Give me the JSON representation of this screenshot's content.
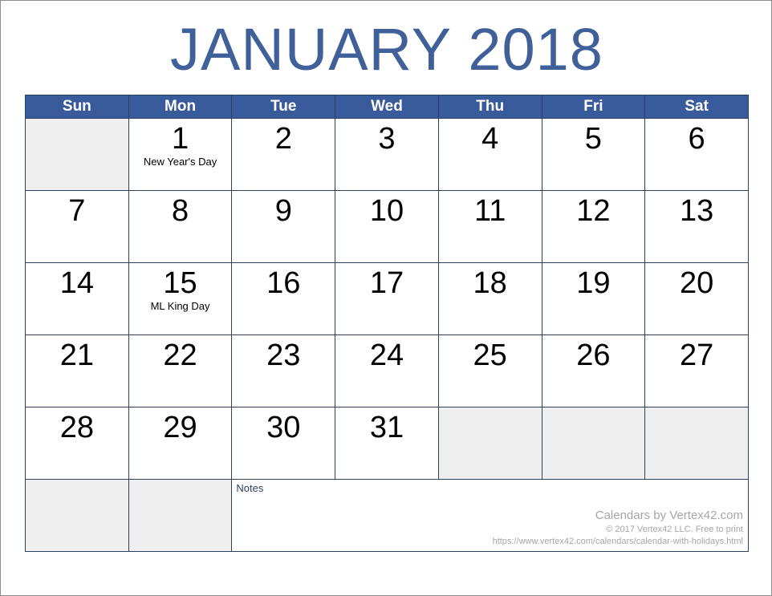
{
  "title": "JANUARY 2018",
  "weekdays": [
    "Sun",
    "Mon",
    "Tue",
    "Wed",
    "Thu",
    "Fri",
    "Sat"
  ],
  "weeks": [
    [
      {
        "day": "",
        "holiday": "",
        "blank": true
      },
      {
        "day": "1",
        "holiday": "New Year's Day",
        "blank": false
      },
      {
        "day": "2",
        "holiday": "",
        "blank": false
      },
      {
        "day": "3",
        "holiday": "",
        "blank": false
      },
      {
        "day": "4",
        "holiday": "",
        "blank": false
      },
      {
        "day": "5",
        "holiday": "",
        "blank": false
      },
      {
        "day": "6",
        "holiday": "",
        "blank": false
      }
    ],
    [
      {
        "day": "7",
        "holiday": "",
        "blank": false
      },
      {
        "day": "8",
        "holiday": "",
        "blank": false
      },
      {
        "day": "9",
        "holiday": "",
        "blank": false
      },
      {
        "day": "10",
        "holiday": "",
        "blank": false
      },
      {
        "day": "11",
        "holiday": "",
        "blank": false
      },
      {
        "day": "12",
        "holiday": "",
        "blank": false
      },
      {
        "day": "13",
        "holiday": "",
        "blank": false
      }
    ],
    [
      {
        "day": "14",
        "holiday": "",
        "blank": false
      },
      {
        "day": "15",
        "holiday": "ML King Day",
        "blank": false
      },
      {
        "day": "16",
        "holiday": "",
        "blank": false
      },
      {
        "day": "17",
        "holiday": "",
        "blank": false
      },
      {
        "day": "18",
        "holiday": "",
        "blank": false
      },
      {
        "day": "19",
        "holiday": "",
        "blank": false
      },
      {
        "day": "20",
        "holiday": "",
        "blank": false
      }
    ],
    [
      {
        "day": "21",
        "holiday": "",
        "blank": false
      },
      {
        "day": "22",
        "holiday": "",
        "blank": false
      },
      {
        "day": "23",
        "holiday": "",
        "blank": false
      },
      {
        "day": "24",
        "holiday": "",
        "blank": false
      },
      {
        "day": "25",
        "holiday": "",
        "blank": false
      },
      {
        "day": "26",
        "holiday": "",
        "blank": false
      },
      {
        "day": "27",
        "holiday": "",
        "blank": false
      }
    ],
    [
      {
        "day": "28",
        "holiday": "",
        "blank": false
      },
      {
        "day": "29",
        "holiday": "",
        "blank": false
      },
      {
        "day": "30",
        "holiday": "",
        "blank": false
      },
      {
        "day": "31",
        "holiday": "",
        "blank": false
      },
      {
        "day": "",
        "holiday": "",
        "blank": true
      },
      {
        "day": "",
        "holiday": "",
        "blank": true
      },
      {
        "day": "",
        "holiday": "",
        "blank": true
      }
    ]
  ],
  "footer": {
    "trailing_blank_cells": 2,
    "notes_label": "Notes",
    "credit_main": "Calendars by Vertex42.com",
    "credit_copyright": "© 2017 Vertex42 LLC. Free to print",
    "credit_url": "https://www.vertex42.com/calendars/calendar-with-holidays.html"
  },
  "colors": {
    "header_blue": "#3a5b9b",
    "title_blue": "#3f6098",
    "grid_border": "#2e3f5e",
    "blank_cell": "#efefef",
    "credit_gray": "#a6a6a6"
  }
}
